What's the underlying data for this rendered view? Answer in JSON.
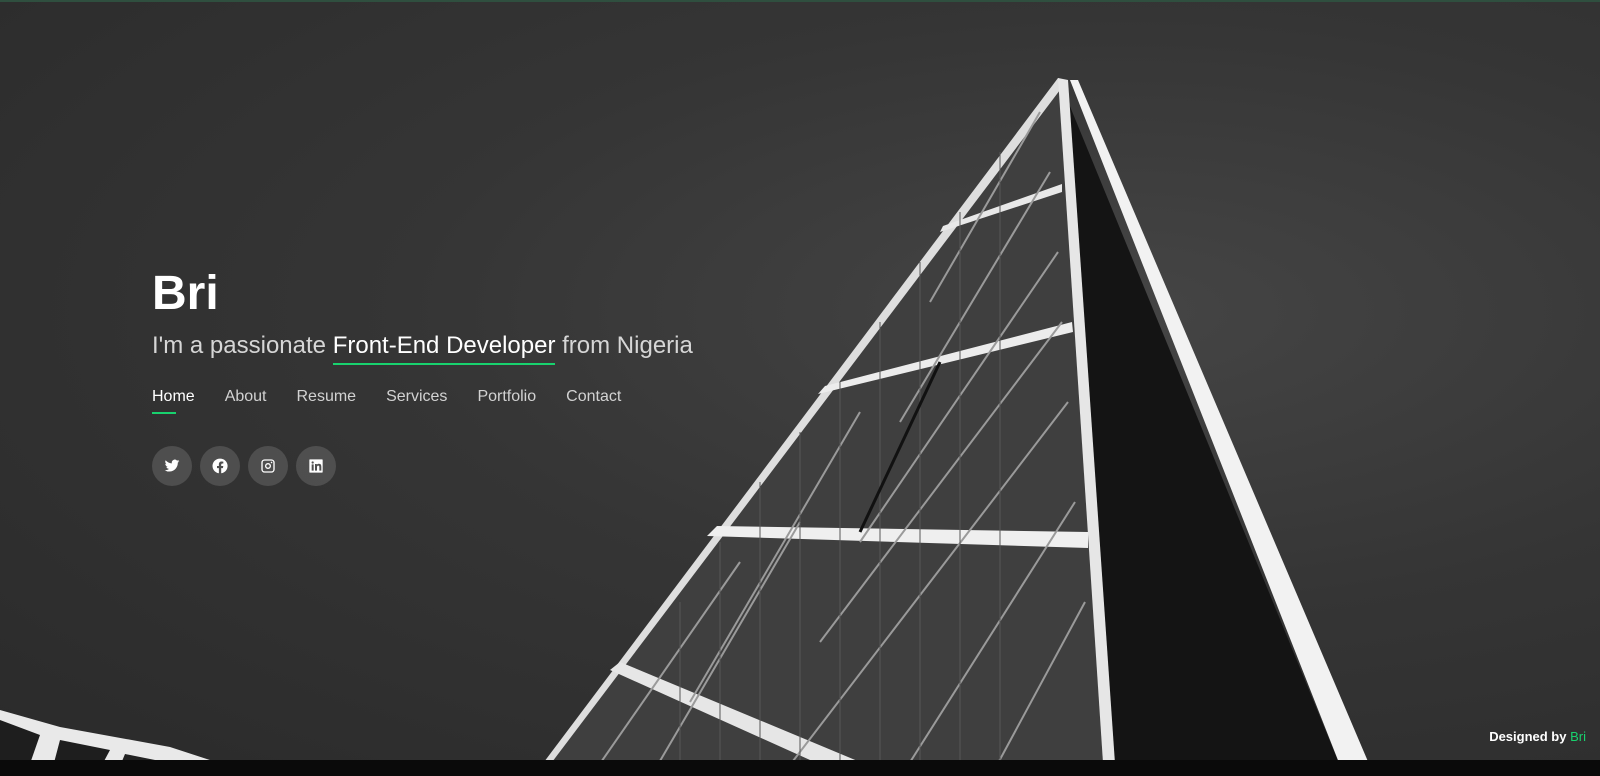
{
  "hero": {
    "name": "Bri",
    "tagline_prefix": "I'm a passionate ",
    "tagline_highlight": "Front-End Developer",
    "tagline_suffix": " from Nigeria"
  },
  "nav": {
    "items": [
      {
        "label": "Home",
        "active": true
      },
      {
        "label": "About"
      },
      {
        "label": "Resume"
      },
      {
        "label": "Services"
      },
      {
        "label": "Portfolio"
      },
      {
        "label": "Contact"
      }
    ]
  },
  "socials": [
    {
      "icon": "twitter-icon"
    },
    {
      "icon": "facebook-icon"
    },
    {
      "icon": "instagram-icon"
    },
    {
      "icon": "linkedin-icon"
    }
  ],
  "footer": {
    "credit_prefix": "Designed by ",
    "credit_brand": "Bri"
  },
  "colors": {
    "accent": "#18d26e",
    "background": "#353535",
    "text": "#ffffff"
  }
}
